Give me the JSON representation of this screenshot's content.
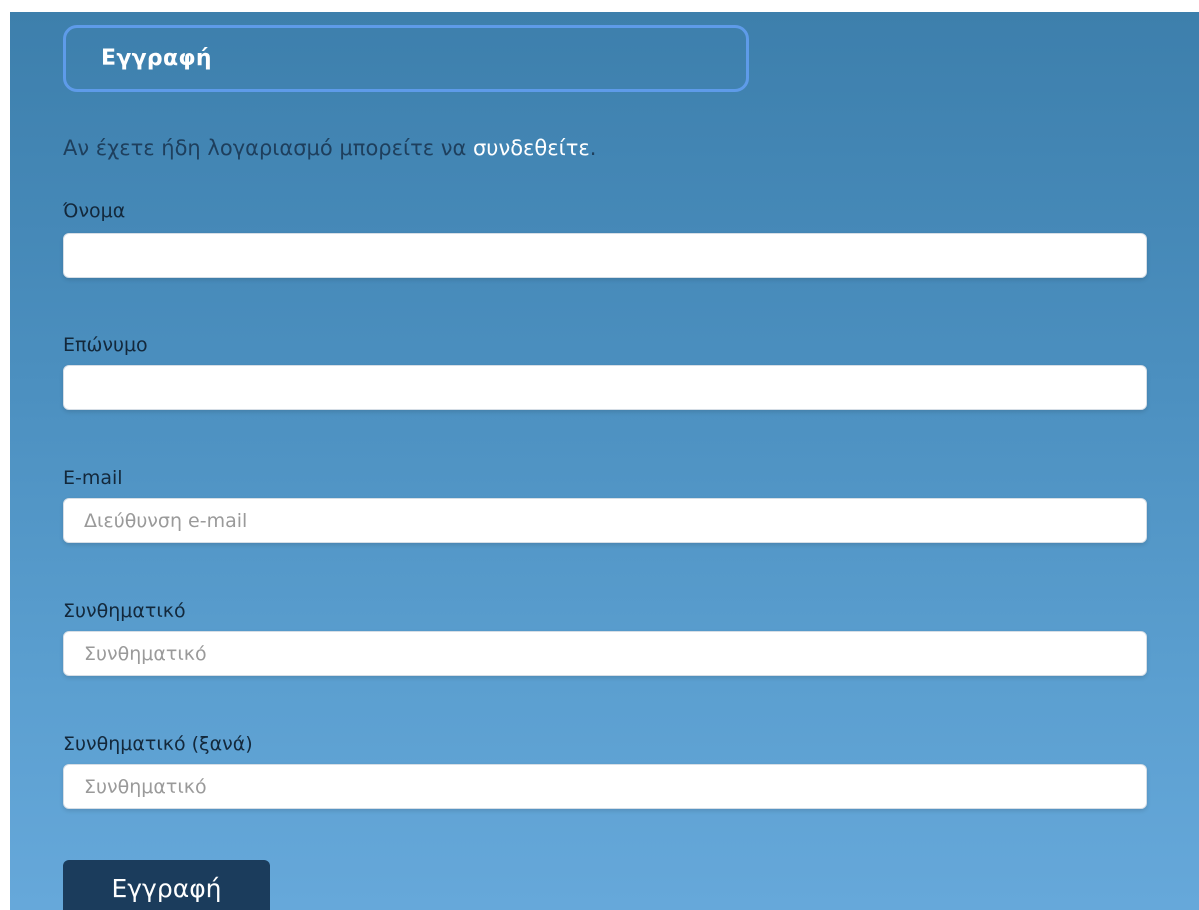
{
  "header": {
    "title": "Εγγραφή"
  },
  "intro": {
    "text": "Αν έχετε ήδη λογαριασμό μπορείτε να ",
    "link_label": "συνδεθείτε",
    "suffix": "."
  },
  "form": {
    "first_name": {
      "label": "Όνομα",
      "value": "",
      "placeholder": ""
    },
    "last_name": {
      "label": "Επώνυμο",
      "value": "",
      "placeholder": ""
    },
    "email": {
      "label": "E-mail",
      "value": "",
      "placeholder": "Διεύθυνση e-mail"
    },
    "password": {
      "label": "Συνθηματικό",
      "value": "",
      "placeholder": "Συνθηματικό"
    },
    "password_repeat": {
      "label": "Συνθηματικό (ξανά)",
      "value": "",
      "placeholder": "Συνθηματικό"
    },
    "submit_label": "Εγγραφή"
  },
  "colors": {
    "background_top": "#3d7fac",
    "background_bottom": "#66a8da",
    "title_border": "#5e9be9",
    "button_background": "#1b3c5c",
    "link": "#ffffff"
  }
}
